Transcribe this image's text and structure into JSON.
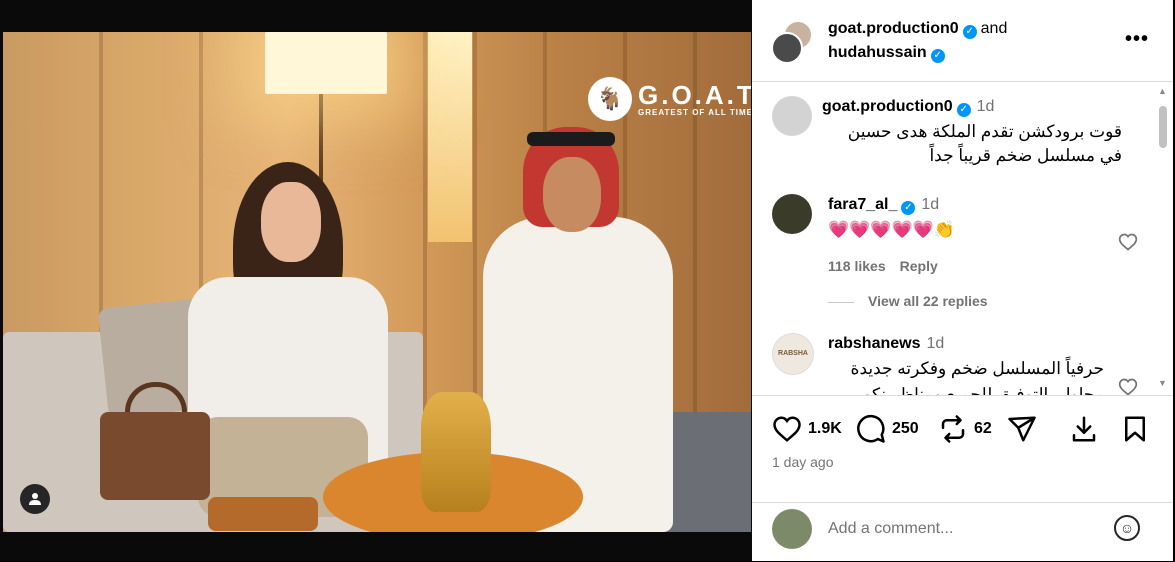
{
  "post": {
    "logo": {
      "brand": "G.O.A.T",
      "tagline": "GREATEST OF ALL TIME"
    },
    "header": {
      "user1": "goat.production0",
      "and": "and",
      "user2": "hudahussain"
    },
    "comments": [
      {
        "user": "goat.production0",
        "ago": "1d",
        "text": "قوت برودكشن تقدم الملكة هدى حسين في مسلسل ضخم قريباً جداً",
        "verified": true
      },
      {
        "user": "fara7_al_",
        "ago": "1d",
        "text": "💗💗💗💗💗👏",
        "likes": "118 likes",
        "reply": "Reply",
        "verified": true
      },
      {
        "user": "rabshanews",
        "ago": "1d",
        "text": "حرفياً المسلسل ضخم وفكرته جديدة",
        "text2": "محاول بالتوفيق للجميع ومناظرينكو"
      }
    ],
    "view_replies": "View all 22 replies",
    "actions": {
      "likes": "1.9K",
      "comments": "250",
      "reposts": "62"
    },
    "date": "1 day ago",
    "composer": {
      "placeholder": "Add a comment..."
    },
    "colors": {
      "verified": "#0095f6",
      "muted": "#737373",
      "divider": "#dbdbdb"
    }
  }
}
